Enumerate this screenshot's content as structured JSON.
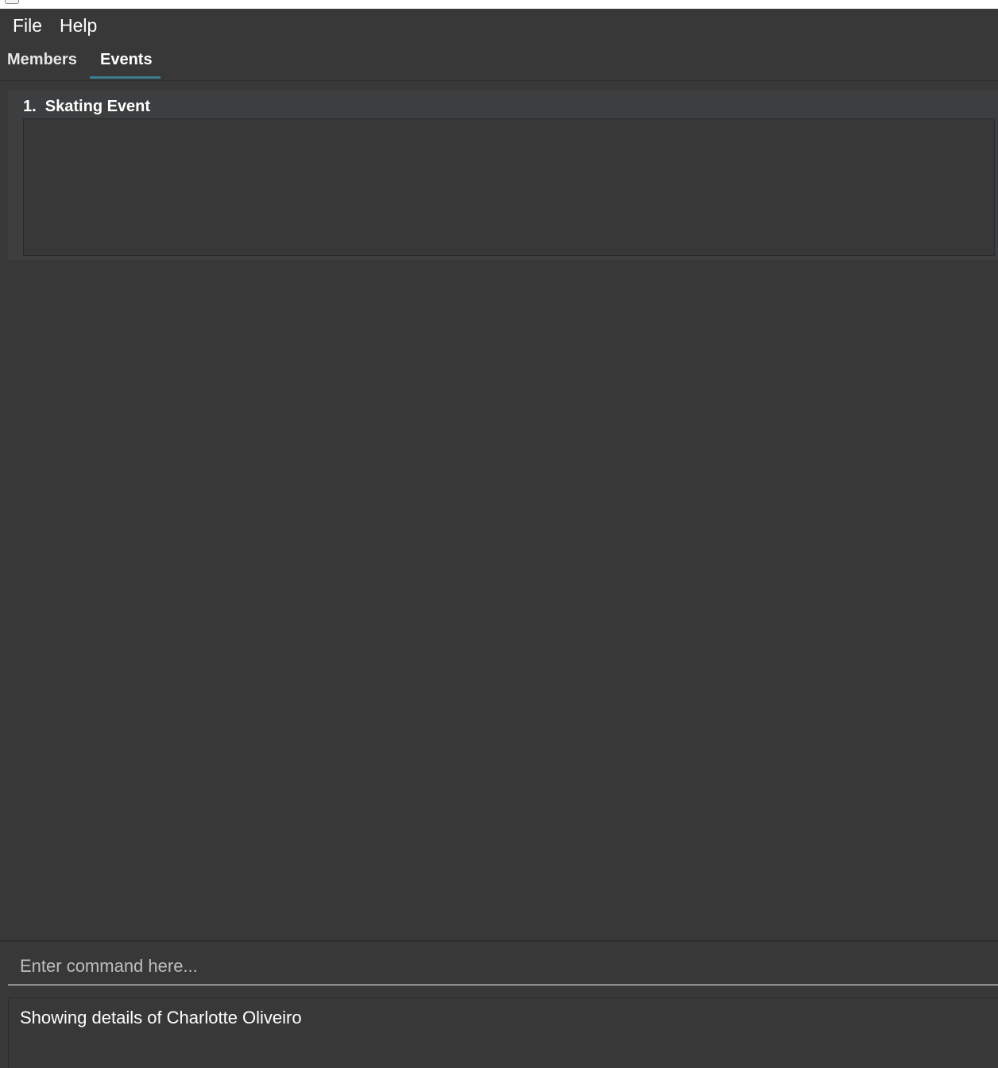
{
  "menu": {
    "file_label": "File",
    "help_label": "Help"
  },
  "tabs": [
    {
      "label": "Members",
      "active": false
    },
    {
      "label": "Events",
      "active": true
    }
  ],
  "events": [
    {
      "title": "1.  Skating Event"
    }
  ],
  "command": {
    "placeholder": "Enter command here...",
    "value": ""
  },
  "result": {
    "message": "Showing details of Charlotte Oliveiro"
  },
  "colors": {
    "background": "#383838",
    "tab_accent": "#3e7b91",
    "card_background": "#3c3e3f"
  }
}
